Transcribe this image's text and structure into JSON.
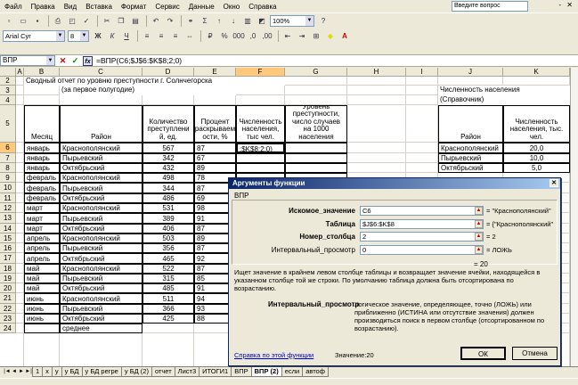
{
  "menu": {
    "items": [
      "Файл",
      "Правка",
      "Вид",
      "Вставка",
      "Формат",
      "Сервис",
      "Данные",
      "Окно",
      "Справка"
    ],
    "help_placeholder": "Введите вопрос",
    "close_glyph": "- ✕"
  },
  "toolbar": {
    "zoom": "100%",
    "font_name": "Arial Cyr",
    "font_size": "8"
  },
  "formula_bar": {
    "name_box": "ВПР",
    "formula": "=ВПР(C6;$J$6:$K$8;2;0)"
  },
  "grid": {
    "columns": [
      "A",
      "B",
      "C",
      "D",
      "E",
      "F",
      "G",
      "H",
      "I",
      "J",
      "K"
    ],
    "selected_col": "F",
    "rows": [
      "2",
      "3",
      "4",
      "5",
      "6",
      "7",
      "8",
      "9",
      "10",
      "11",
      "12",
      "13",
      "14",
      "15",
      "16",
      "17",
      "18",
      "19",
      "20",
      "21",
      "22",
      "23",
      "24"
    ],
    "selected_row": "6",
    "title": "Сводный отчет по уровню преступности г. Солнчегорска",
    "subtitle": "(за первое полугодие)",
    "headers": {
      "month": "Месяц",
      "district": "Район",
      "crimes": "Количество преступлени й, ед.",
      "percent": "Процент раскрываем ости, %",
      "population": "Численность населения, тыс чел.",
      "level": "Уровень преступности, число случаев на 1000 населения"
    },
    "active_cell_text": ";$K$8;2;0)",
    "data_rows": [
      {
        "month": "январь",
        "district": "Краснополянский",
        "crimes": "567",
        "percent": "87"
      },
      {
        "month": "январь",
        "district": "Пырьевский",
        "crimes": "342",
        "percent": "67"
      },
      {
        "month": "январь",
        "district": "Октябрьский",
        "crimes": "432",
        "percent": "89"
      },
      {
        "month": "февраль",
        "district": "Краснополянский",
        "crimes": "498",
        "percent": "78"
      },
      {
        "month": "февраль",
        "district": "Пырьевский",
        "crimes": "344",
        "percent": "87"
      },
      {
        "month": "февраль",
        "district": "Октябрьский",
        "crimes": "486",
        "percent": "69"
      },
      {
        "month": "март",
        "district": "Краснополянский",
        "crimes": "531",
        "percent": "98"
      },
      {
        "month": "март",
        "district": "Пырьевский",
        "crimes": "389",
        "percent": "91"
      },
      {
        "month": "март",
        "district": "Октябрьский",
        "crimes": "406",
        "percent": "87"
      },
      {
        "month": "апрель",
        "district": "Краснополянский",
        "crimes": "503",
        "percent": "89"
      },
      {
        "month": "апрель",
        "district": "Пырьевский",
        "crimes": "356",
        "percent": "87"
      },
      {
        "month": "апрель",
        "district": "Октябрьский",
        "crimes": "465",
        "percent": "92"
      },
      {
        "month": "май",
        "district": "Краснополянский",
        "crimes": "522",
        "percent": "87"
      },
      {
        "month": "май",
        "district": "Пырьевский",
        "crimes": "315",
        "percent": "85"
      },
      {
        "month": "май",
        "district": "Октябрьский",
        "crimes": "485",
        "percent": "91"
      },
      {
        "month": "июнь",
        "district": "Краснополянский",
        "crimes": "511",
        "percent": "94"
      },
      {
        "month": "июнь",
        "district": "Пырьевский",
        "crimes": "366",
        "percent": "93"
      },
      {
        "month": "июнь",
        "district": "Октябрьский",
        "crimes": "425",
        "percent": "88"
      }
    ],
    "avg_label": "среднее",
    "ref": {
      "title": "Численность населения",
      "subtitle": "(Справочник)",
      "h_district": "Район",
      "h_population": "Численность населения, тыс. чел.",
      "rows": [
        {
          "district": "Краснополянский",
          "value": "20,0"
        },
        {
          "district": "Пырьевский",
          "value": "10,0"
        },
        {
          "district": "Октябрьский",
          "value": "5,0"
        }
      ]
    }
  },
  "sheet_tabs": [
    "1",
    "х",
    "у",
    "у БД",
    "у БД регре",
    "у БД (2)",
    "отчет",
    "Лист3",
    "ИТОГИ1",
    "ВПР",
    "ВПР (2)",
    "если",
    "автоф"
  ],
  "active_tab": "ВПР (2)",
  "dialog": {
    "title": "Аргументы функции",
    "close": "✕",
    "function_name": "ВПР",
    "args": [
      {
        "label": "Искомое_значение",
        "bold": true,
        "value": "C6",
        "result": "= \"Краснополянский\""
      },
      {
        "label": "Таблица",
        "bold": true,
        "value": "$J$6:$K$8",
        "result": "= {\"Краснополянский\""
      },
      {
        "label": "Номер_столбца",
        "bold": true,
        "value": "2",
        "result": "= 2"
      },
      {
        "label": "Интервальный_просмотр",
        "bold": false,
        "value": "0",
        "result": "= ЛОЖЬ"
      }
    ],
    "result": "= 20",
    "description": "Ищет значение в крайнем левом столбце таблицы и возвращает значение ячейки, находящейся в указанном столбце той же строки. По умолчанию таблица должна быть отсортирована по возрастанию.",
    "param_name": "Интервальный_просмотр",
    "param_desc": "логическое значение, определяющее, точно (ЛОЖЬ) или приближенно (ИСТИНА или отсутствие значения) должен производиться поиск в первом столбце (отсортированном по возрастанию).",
    "help_link": "Справка по этой функции",
    "value_label": "Значение:20",
    "ok": "ОК",
    "cancel": "Отмена"
  }
}
